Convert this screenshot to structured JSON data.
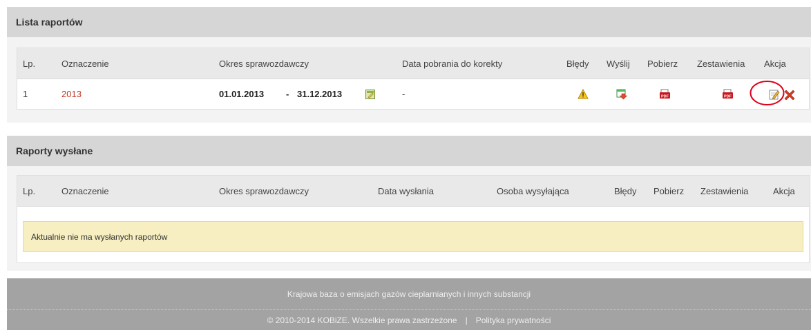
{
  "reports": {
    "title": "Lista raportów",
    "headers": {
      "lp": "Lp.",
      "designation": "Oznaczenie",
      "period": "Okres sprawozdawczy",
      "download_date": "Data pobrania do korekty",
      "errors": "Błędy",
      "send": "Wyślij",
      "download": "Pobierz",
      "summaries": "Zestawienia",
      "action": "Akcja"
    },
    "rows": [
      {
        "lp": "1",
        "designation": "2013",
        "period_from": "01.01.2013",
        "period_sep": "-",
        "period_to": "31.12.2013",
        "download_date": "-"
      }
    ]
  },
  "sent": {
    "title": "Raporty wysłane",
    "headers": {
      "lp": "Lp.",
      "designation": "Oznaczenie",
      "period": "Okres sprawozdawczy",
      "sent_date": "Data wysłania",
      "sender": "Osoba wysyłająca",
      "errors": "Błędy",
      "download": "Pobierz",
      "summaries": "Zestawienia",
      "action": "Akcja"
    },
    "empty_message": "Aktualnie nie ma wysłanych raportów"
  },
  "footer": {
    "line1": "Krajowa baza o emisjach gazów cieplarnianych i innych substancji",
    "copyright": "© 2010-2014 KOBiZE. Wszelkie prawa zastrzeżone",
    "separator": "|",
    "privacy": "Polityka prywatności"
  },
  "icons": {
    "edit_period": "calendar-edit-icon",
    "errors": "warning-icon",
    "send": "send-icon",
    "download": "pdf-icon",
    "summaries": "pdf-icon",
    "edit": "edit-icon",
    "delete": "delete-icon"
  },
  "colors": {
    "link": "#c0392b",
    "header_bg": "#d6d6d6",
    "empty_bg": "#f7efc2",
    "footer_bg": "#a3a3a3",
    "highlight_circle": "#e0001b"
  }
}
